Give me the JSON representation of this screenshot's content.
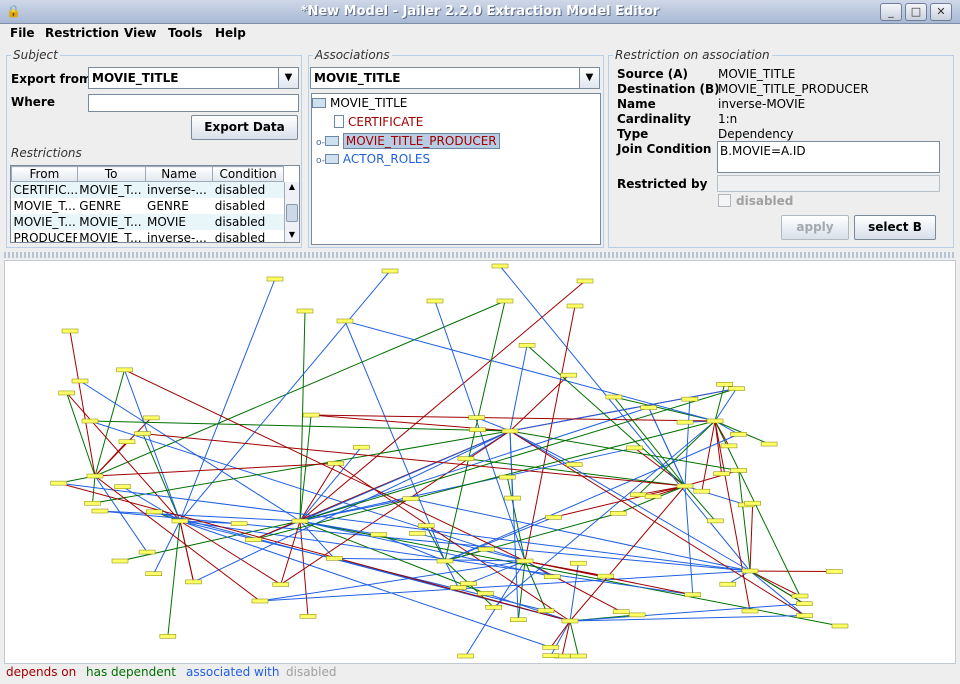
{
  "window": {
    "title": "*New Model - Jailer 2.2.0 Extraction Model Editor"
  },
  "menu": [
    "File",
    "Restriction",
    "View",
    "Tools",
    "Help"
  ],
  "subject": {
    "title": "Subject",
    "export_from_label": "Export from",
    "export_from_value": "MOVIE_TITLE",
    "where_label": "Where",
    "where_value": "",
    "export_button": "Export Data",
    "restrictions_label": "Restrictions",
    "columns": [
      "From",
      "To",
      "Name",
      "Condition"
    ],
    "rows": [
      [
        "CERTIFIC...",
        "MOVIE_T...",
        "inverse-...",
        "disabled"
      ],
      [
        "MOVIE_T...",
        "GENRE",
        "GENRE",
        "disabled"
      ],
      [
        "MOVIE_T...",
        "MOVIE_T...",
        "MOVIE",
        "disabled"
      ],
      [
        "PRODUCER",
        "MOVIE_T...",
        "inverse-...",
        "disabled"
      ]
    ]
  },
  "associations": {
    "title": "Associations",
    "combo_value": "MOVIE_TITLE",
    "tree": {
      "root": "MOVIE_TITLE",
      "children": [
        "CERTIFICATE",
        "MOVIE_TITLE_PRODUCER",
        "ACTOR_ROLES"
      ]
    }
  },
  "restriction": {
    "title": "Restriction on association",
    "source_label": "Source (A)",
    "source_value": "MOVIE_TITLE",
    "destination_label": "Destination (B)",
    "destination_value": "MOVIE_TITLE_PRODUCER",
    "name_label": "Name",
    "name_value": "inverse-MOVIE",
    "cardinality_label": "Cardinality",
    "cardinality_value": "1:n",
    "type_label": "Type",
    "type_value": "Dependency",
    "join_label": "Join Condition",
    "join_value": "B.MOVIE=A.ID",
    "restricted_by_label": "Restricted by",
    "restricted_by_value": "",
    "disabled_label": "disabled",
    "apply_button": "apply",
    "select_b_button": "select B"
  },
  "legend": {
    "depends_on": "depends on",
    "has_dependent": "has dependent",
    "associated_with": "associated with",
    "disabled": "disabled"
  },
  "colors": {
    "depends_on": "#a00000",
    "has_dependent": "#007000",
    "associated_with": "#2060e0",
    "disabled": "#a0a0a0",
    "node_fill": "#ffff66"
  }
}
